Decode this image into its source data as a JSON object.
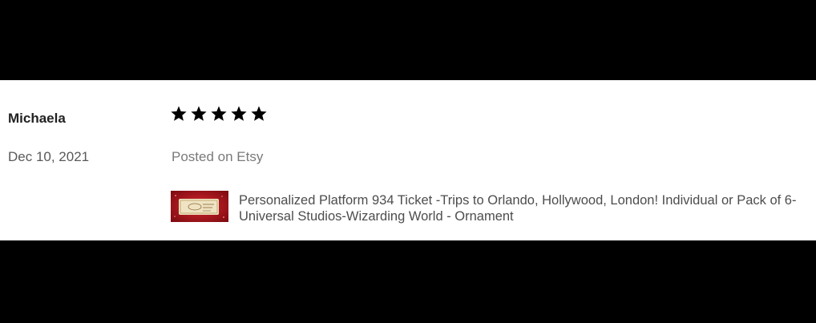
{
  "review": {
    "reviewer_name": "Michaela",
    "date": "Dec 10, 2021",
    "rating": 5,
    "rating_max": 5,
    "star_color": "#000000",
    "posted_on": "Posted on Etsy",
    "listing": {
      "title": "Personalized Platform 934 Ticket -Trips to Orlando, Hollywood, London! Individual or Pack of 6- Universal Studios-Wizarding World - Ornament",
      "thumbnail_icon": "ticket-thumbnail"
    }
  },
  "colors": {
    "background_band": "#000000",
    "card_background": "#ffffff",
    "name_text": "#222222",
    "muted_text": "#7a7a7a",
    "listing_text": "#4d4d4d",
    "thumbnail_red": "#b0141c"
  }
}
